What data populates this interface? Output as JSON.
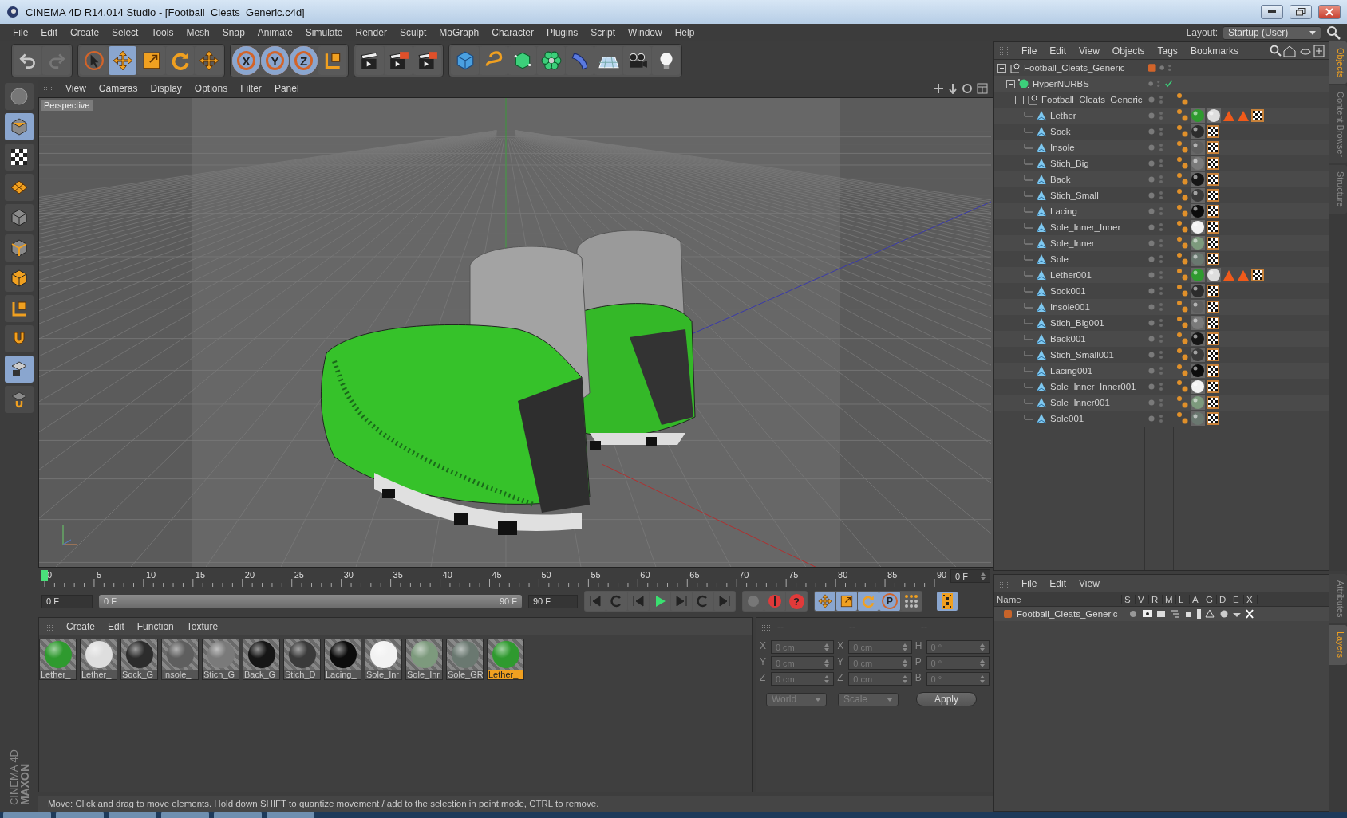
{
  "window": {
    "title": "CINEMA 4D R14.014 Studio - [Football_Cleats_Generic.c4d]"
  },
  "menu": [
    "File",
    "Edit",
    "Create",
    "Select",
    "Tools",
    "Mesh",
    "Snap",
    "Animate",
    "Simulate",
    "Render",
    "Sculpt",
    "MoGraph",
    "Character",
    "Plugins",
    "Script",
    "Window",
    "Help"
  ],
  "layout": {
    "label": "Layout:",
    "value": "Startup (User)"
  },
  "toolbar": [
    {
      "items": [
        {
          "kind": "undo",
          "selected": false
        },
        {
          "kind": "redo",
          "selected": false
        }
      ]
    },
    {
      "items": [
        {
          "kind": "pointer",
          "selected": false
        },
        {
          "kind": "move",
          "selected": true
        },
        {
          "kind": "scale",
          "selected": false
        },
        {
          "kind": "rotate",
          "selected": false
        },
        {
          "kind": "plus",
          "selected": false
        }
      ]
    },
    {
      "items": [
        {
          "kind": "axis",
          "label": "X",
          "selected": true
        },
        {
          "kind": "axis",
          "label": "Y",
          "selected": true
        },
        {
          "kind": "axis",
          "label": "Z",
          "selected": true
        },
        {
          "kind": "coord",
          "selected": false
        }
      ]
    },
    {
      "items": [
        {
          "kind": "clapper",
          "selected": false
        },
        {
          "kind": "clapper-window",
          "selected": false
        },
        {
          "kind": "clapper-gear",
          "selected": false
        }
      ]
    },
    {
      "items": [
        {
          "kind": "cube",
          "selected": false
        },
        {
          "kind": "spline",
          "selected": false
        },
        {
          "kind": "nurbs",
          "selected": false
        },
        {
          "kind": "array",
          "selected": false
        },
        {
          "kind": "deformer",
          "selected": false
        },
        {
          "kind": "floor",
          "selected": false
        },
        {
          "kind": "camera",
          "selected": false
        },
        {
          "kind": "light",
          "selected": false
        }
      ]
    }
  ],
  "left_tools": [
    {
      "kind": "model",
      "selected": false
    },
    {
      "kind": "object",
      "selected": true
    },
    {
      "kind": "checker",
      "selected": false
    },
    {
      "kind": "workplane",
      "selected": false
    },
    {
      "kind": "points",
      "selected": false
    },
    {
      "kind": "edges",
      "selected": false
    },
    {
      "kind": "polygons",
      "selected": false
    },
    {
      "kind": "coord",
      "selected": false
    },
    {
      "kind": "magnet",
      "selected": false
    },
    {
      "kind": "snap-grid",
      "selected": true
    },
    {
      "kind": "lock-grid",
      "selected": false
    }
  ],
  "viewport": {
    "menu": [
      "View",
      "Cameras",
      "Display",
      "Options",
      "Filter",
      "Panel"
    ],
    "camera": "Perspective"
  },
  "timeline": {
    "ticks": [
      "0",
      "5",
      "10",
      "15",
      "20",
      "25",
      "30",
      "35",
      "40",
      "45",
      "50",
      "55",
      "60",
      "65",
      "70",
      "75",
      "80",
      "85",
      "90"
    ],
    "playhead": {
      "level": 0
    },
    "range": {
      "level": 1
    },
    "current": "0 F",
    "start": "0 F",
    "range_start": "0 F",
    "range_end": "90 F",
    "end": "90 F",
    "help": "?",
    "param": "P"
  },
  "materials": {
    "menu": [
      "Create",
      "Edit",
      "Function",
      "Texture"
    ],
    "items": [
      {
        "label": "Lether_",
        "color": "#2f9a2f",
        "selected": false
      },
      {
        "label": "Lether_",
        "color": "#dedede",
        "selected": false
      },
      {
        "label": "Sock_G",
        "color": "#2c2c2c",
        "selected": false
      },
      {
        "label": "Insole_",
        "color": "#5e5e5e",
        "selected": false
      },
      {
        "label": "Stich_G",
        "color": "#7a7a7a",
        "selected": false
      },
      {
        "label": "Back_G",
        "color": "#161616",
        "selected": false
      },
      {
        "label": "Stich_D",
        "color": "#3a3a3a",
        "selected": false
      },
      {
        "label": "Lacing_",
        "color": "#0c0c0c",
        "selected": false
      },
      {
        "label": "Sole_Inr",
        "color": "#f2f2f2",
        "selected": false
      },
      {
        "label": "Sole_Inr",
        "color": "#7d9a7d",
        "selected": false
      },
      {
        "label": "Sole_GR",
        "color": "#6a7870",
        "selected": false
      },
      {
        "label": "Lether_",
        "color": "#2f9a2f",
        "selected": true
      }
    ]
  },
  "coordinates": {
    "disabled": true,
    "headers": [
      "--",
      "--",
      "--"
    ],
    "rows": [
      {
        "fields": [
          {
            "axis": "X",
            "value": "0 cm"
          },
          {
            "axis": "X",
            "value": "0 cm"
          },
          {
            "axis": "H",
            "value": "0 °"
          }
        ]
      },
      {
        "fields": [
          {
            "axis": "Y",
            "value": "0 cm"
          },
          {
            "axis": "Y",
            "value": "0 cm"
          },
          {
            "axis": "P",
            "value": "0 °"
          }
        ]
      },
      {
        "fields": [
          {
            "axis": "Z",
            "value": "0 cm"
          },
          {
            "axis": "Z",
            "value": "0 cm"
          },
          {
            "axis": "B",
            "value": "0 °"
          }
        ]
      }
    ],
    "dropdowns": [
      "World",
      "Scale"
    ],
    "apply": "Apply"
  },
  "objects": {
    "menu": [
      "File",
      "Edit",
      "View",
      "Objects",
      "Tags",
      "Bookmarks"
    ],
    "tree": [
      {
        "name": "Football_Cleats_Generic",
        "kind": "null",
        "color": "#d2642a",
        "expanded": true,
        "children": [
          {
            "name": "HyperNURBS",
            "kind": "nurbs",
            "enabled": true,
            "expanded": true,
            "children": [
              {
                "name": "Football_Cleats_Generic",
                "kind": "null",
                "expanded": true,
                "tags": [
                  {
                    "kind": "phong"
                  }
                ],
                "children": [
                  {
                    "name": "Lether",
                    "kind": "polygon",
                    "tags": [
                      {
                        "kind": "phong"
                      },
                      {
                        "kind": "material",
                        "color": "#2f9a2f"
                      },
                      {
                        "kind": "material",
                        "color": "#dedede"
                      },
                      {
                        "kind": "warning"
                      },
                      {
                        "kind": "warning"
                      },
                      {
                        "kind": "uvw"
                      }
                    ]
                  },
                  {
                    "name": "Sock",
                    "kind": "polygon",
                    "tags": [
                      {
                        "kind": "phong"
                      },
                      {
                        "kind": "material",
                        "color": "#2c2c2c"
                      },
                      {
                        "kind": "uvw"
                      }
                    ]
                  },
                  {
                    "name": "Insole",
                    "kind": "polygon",
                    "tags": [
                      {
                        "kind": "phong"
                      },
                      {
                        "kind": "material",
                        "color": "#5e5e5e"
                      },
                      {
                        "kind": "uvw"
                      }
                    ]
                  },
                  {
                    "name": "Stich_Big",
                    "kind": "polygon",
                    "tags": [
                      {
                        "kind": "phong"
                      },
                      {
                        "kind": "material",
                        "color": "#7a7a7a"
                      },
                      {
                        "kind": "uvw"
                      }
                    ]
                  },
                  {
                    "name": "Back",
                    "kind": "polygon",
                    "tags": [
                      {
                        "kind": "phong"
                      },
                      {
                        "kind": "material",
                        "color": "#161616"
                      },
                      {
                        "kind": "uvw"
                      }
                    ]
                  },
                  {
                    "name": "Stich_Small",
                    "kind": "polygon",
                    "tags": [
                      {
                        "kind": "phong"
                      },
                      {
                        "kind": "material",
                        "color": "#3a3a3a"
                      },
                      {
                        "kind": "uvw"
                      }
                    ]
                  },
                  {
                    "name": "Lacing",
                    "kind": "polygon",
                    "tags": [
                      {
                        "kind": "phong"
                      },
                      {
                        "kind": "material",
                        "color": "#0c0c0c"
                      },
                      {
                        "kind": "uvw"
                      }
                    ]
                  },
                  {
                    "name": "Sole_Inner_Inner",
                    "kind": "polygon",
                    "tags": [
                      {
                        "kind": "phong"
                      },
                      {
                        "kind": "material",
                        "color": "#f2f2f2"
                      },
                      {
                        "kind": "uvw"
                      }
                    ]
                  },
                  {
                    "name": "Sole_Inner",
                    "kind": "polygon",
                    "tags": [
                      {
                        "kind": "phong"
                      },
                      {
                        "kind": "material",
                        "color": "#7d9a7d"
                      },
                      {
                        "kind": "uvw"
                      }
                    ]
                  },
                  {
                    "name": "Sole",
                    "kind": "polygon",
                    "tags": [
                      {
                        "kind": "phong"
                      },
                      {
                        "kind": "material",
                        "color": "#6a7870"
                      },
                      {
                        "kind": "uvw"
                      }
                    ]
                  },
                  {
                    "name": "Lether001",
                    "kind": "polygon",
                    "tags": [
                      {
                        "kind": "phong"
                      },
                      {
                        "kind": "material",
                        "color": "#2f9a2f"
                      },
                      {
                        "kind": "material",
                        "color": "#dedede"
                      },
                      {
                        "kind": "warning"
                      },
                      {
                        "kind": "warning"
                      },
                      {
                        "kind": "uvw"
                      }
                    ]
                  },
                  {
                    "name": "Sock001",
                    "kind": "polygon",
                    "tags": [
                      {
                        "kind": "phong"
                      },
                      {
                        "kind": "material",
                        "color": "#2c2c2c"
                      },
                      {
                        "kind": "uvw"
                      }
                    ]
                  },
                  {
                    "name": "Insole001",
                    "kind": "polygon",
                    "tags": [
                      {
                        "kind": "phong"
                      },
                      {
                        "kind": "material",
                        "color": "#5e5e5e"
                      },
                      {
                        "kind": "uvw"
                      }
                    ]
                  },
                  {
                    "name": "Stich_Big001",
                    "kind": "polygon",
                    "tags": [
                      {
                        "kind": "phong"
                      },
                      {
                        "kind": "material",
                        "color": "#7a7a7a"
                      },
                      {
                        "kind": "uvw"
                      }
                    ]
                  },
                  {
                    "name": "Back001",
                    "kind": "polygon",
                    "tags": [
                      {
                        "kind": "phong"
                      },
                      {
                        "kind": "material",
                        "color": "#161616"
                      },
                      {
                        "kind": "uvw"
                      }
                    ]
                  },
                  {
                    "name": "Stich_Small001",
                    "kind": "polygon",
                    "tags": [
                      {
                        "kind": "phong"
                      },
                      {
                        "kind": "material",
                        "color": "#3a3a3a"
                      },
                      {
                        "kind": "uvw"
                      }
                    ]
                  },
                  {
                    "name": "Lacing001",
                    "kind": "polygon",
                    "tags": [
                      {
                        "kind": "phong"
                      },
                      {
                        "kind": "material",
                        "color": "#0c0c0c"
                      },
                      {
                        "kind": "uvw"
                      }
                    ]
                  },
                  {
                    "name": "Sole_Inner_Inner001",
                    "kind": "polygon",
                    "tags": [
                      {
                        "kind": "phong"
                      },
                      {
                        "kind": "material",
                        "color": "#f2f2f2"
                      },
                      {
                        "kind": "uvw"
                      }
                    ]
                  },
                  {
                    "name": "Sole_Inner001",
                    "kind": "polygon",
                    "tags": [
                      {
                        "kind": "phong"
                      },
                      {
                        "kind": "material",
                        "color": "#7d9a7d"
                      },
                      {
                        "kind": "uvw"
                      }
                    ]
                  },
                  {
                    "name": "Sole001",
                    "kind": "polygon",
                    "tags": [
                      {
                        "kind": "phong"
                      },
                      {
                        "kind": "material",
                        "color": "#6a7870"
                      },
                      {
                        "kind": "uvw"
                      }
                    ]
                  }
                ]
              }
            ]
          }
        ]
      }
    ]
  },
  "side_tabs_top": [
    {
      "label": "Objects",
      "selected": true
    },
    {
      "label": "Content Browser",
      "selected": false
    },
    {
      "label": "Structure",
      "selected": false
    }
  ],
  "layers": {
    "menu": [
      "File",
      "Edit",
      "View"
    ],
    "columns": [
      "Name",
      "S",
      "V",
      "R",
      "M",
      "L",
      "A",
      "G",
      "D",
      "E",
      "X"
    ],
    "rows": [
      {
        "name": "Football_Cleats_Generic",
        "color": "#c8642a"
      }
    ]
  },
  "side_tabs_bottom": [
    {
      "label": "Attributes",
      "selected": false
    },
    {
      "label": "Layers",
      "selected": true
    }
  ],
  "logo": {
    "brand": "MAXON",
    "product": "CINEMA 4D"
  },
  "status": "Move: Click and drag to move elements. Hold down SHIFT to quantize movement / add to the selection in point mode, CTRL to remove."
}
